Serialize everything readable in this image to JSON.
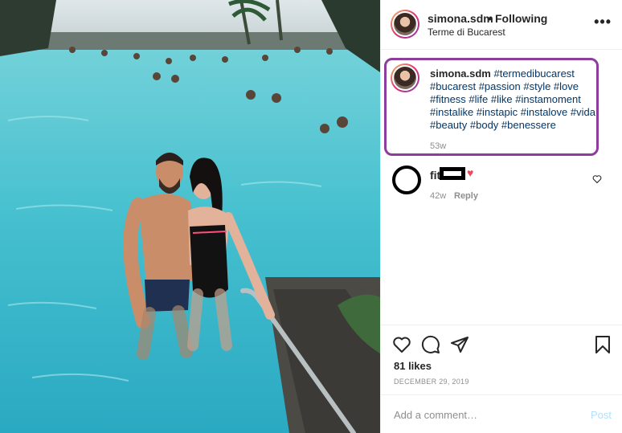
{
  "post": {
    "username": "simona.sdm",
    "dot": "•",
    "follow_status": "Following",
    "location": "Terme di Bucarest",
    "more_icon": "more-options-icon"
  },
  "caption": {
    "username": "simona.sdm",
    "hashtags": "#termedibucarest #bucarest #passion #style #love #fitness #life #like #instamoment #instalike #instapic #instalove #vida #beauty #body #benessere",
    "time": "53w"
  },
  "comment": {
    "name_visible": "fit",
    "time": "42w",
    "reply_label": "Reply"
  },
  "actions": {
    "likes": "81 likes",
    "date": "DECEMBER 29, 2019",
    "comment_placeholder": "Add a comment…",
    "post_label": "Post"
  },
  "colors": {
    "accent_outline": "#8e3c9e",
    "link": "#00376b",
    "muted": "#8e8e8e",
    "heart": "#ed4956",
    "post_disabled": "#b2dffc"
  }
}
